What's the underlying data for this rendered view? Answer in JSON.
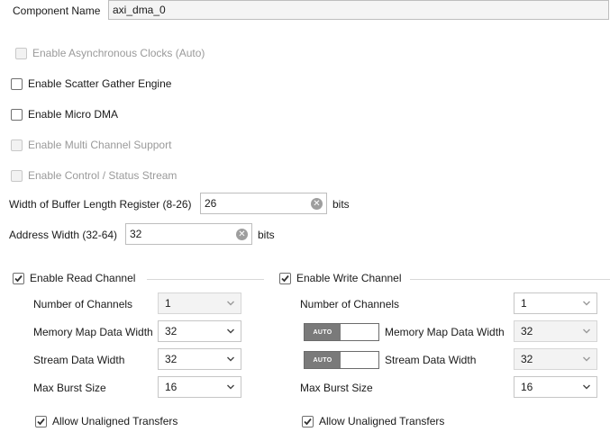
{
  "component": {
    "label": "Component Name",
    "value": "axi_dma_0"
  },
  "options": {
    "async_clocks": {
      "label": "Enable Asynchronous Clocks (Auto)",
      "checked": false,
      "enabled": false
    },
    "scatter_gather": {
      "label": "Enable Scatter Gather Engine",
      "checked": false,
      "enabled": true
    },
    "micro_dma": {
      "label": "Enable Micro DMA",
      "checked": false,
      "enabled": true
    },
    "multi_channel": {
      "label": "Enable Multi Channel Support",
      "checked": false,
      "enabled": false
    },
    "control_status": {
      "label": "Enable Control / Status Stream",
      "checked": false,
      "enabled": false
    }
  },
  "buffer_length": {
    "label": "Width of Buffer Length Register (8-26)",
    "value": "26",
    "unit": "bits"
  },
  "address_width": {
    "label": "Address Width (32-64)",
    "value": "32",
    "unit": "bits"
  },
  "read_channel": {
    "header": "Enable Read Channel",
    "checked": true,
    "num_channels": {
      "label": "Number of Channels",
      "value": "1"
    },
    "mm_data_width": {
      "label": "Memory Map Data Width",
      "value": "32"
    },
    "stream_data_width": {
      "label": "Stream Data Width",
      "value": "32"
    },
    "max_burst": {
      "label": "Max Burst Size",
      "value": "16"
    },
    "unaligned": {
      "label": "Allow Unaligned Transfers",
      "checked": true
    }
  },
  "write_channel": {
    "header": "Enable Write Channel",
    "checked": true,
    "num_channels": {
      "label": "Number of Channels",
      "value": "1"
    },
    "auto_label": "AUTO",
    "mm_data_width": {
      "label": "Memory Map Data Width",
      "value": "32"
    },
    "stream_data_width": {
      "label": "Stream Data Width",
      "value": "32"
    },
    "max_burst": {
      "label": "Max Burst Size",
      "value": "16"
    },
    "unaligned": {
      "label": "Allow Unaligned Transfers",
      "checked": true
    }
  }
}
